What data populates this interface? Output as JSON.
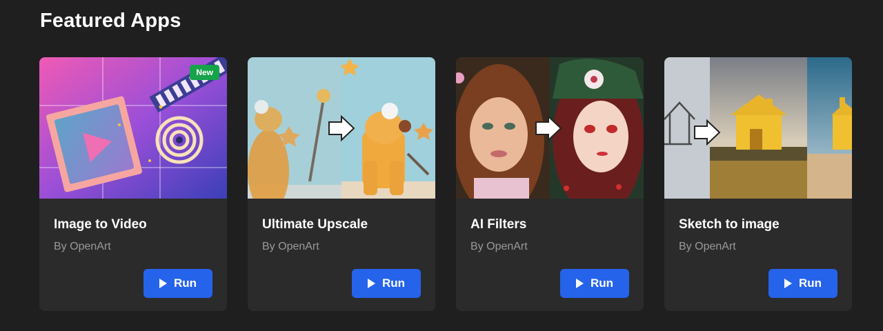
{
  "section": {
    "title": "Featured Apps"
  },
  "badges": {
    "new": "New"
  },
  "cards": [
    {
      "title": "Image to Video",
      "author": "By OpenArt",
      "run_label": "Run",
      "icon": "play-icon",
      "badge": "New"
    },
    {
      "title": "Ultimate Upscale",
      "author": "By OpenArt",
      "run_label": "Run",
      "icon": "play-icon"
    },
    {
      "title": "AI Filters",
      "author": "By OpenArt",
      "run_label": "Run",
      "icon": "play-icon"
    },
    {
      "title": "Sketch to image",
      "author": "By OpenArt",
      "run_label": "Run",
      "icon": "play-icon"
    }
  ],
  "colors": {
    "background": "#1f1f1f",
    "card": "#2b2b2b",
    "accent": "#2563eb",
    "badge": "#16a34a",
    "muted_text": "#9a9a9a"
  }
}
